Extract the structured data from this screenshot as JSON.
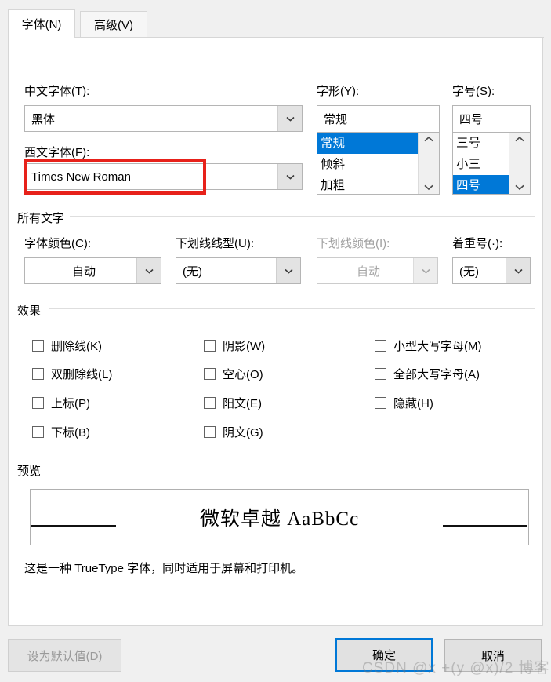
{
  "window": {
    "tabs": [
      {
        "id": "font",
        "label": "字体(N)"
      },
      {
        "id": "advanced",
        "label": "高级(V)"
      }
    ],
    "active_tab": "字体(N)"
  },
  "font_section": {
    "chinese_font": {
      "label": "中文字体(T):",
      "value": "黑体"
    },
    "western_font": {
      "label": "西文字体(F):",
      "value": "Times New Roman",
      "highlighted": true
    },
    "font_style": {
      "label": "字形(Y):",
      "value": "常规",
      "options": [
        "常规",
        "倾斜",
        "加粗"
      ],
      "selected": "常规"
    },
    "font_size": {
      "label": "字号(S):",
      "value": "四号",
      "options": [
        "三号",
        "小三",
        "四号"
      ],
      "selected": "四号"
    }
  },
  "all_text": {
    "group_title": "所有文字",
    "font_color": {
      "label": "字体颜色(C):",
      "value": "自动",
      "disabled": false
    },
    "underline_style": {
      "label": "下划线线型(U):",
      "value": "(无)",
      "disabled": false
    },
    "underline_color": {
      "label": "下划线颜色(I):",
      "value": "自动",
      "disabled": true
    },
    "emphasis_mark": {
      "label": "着重号(·):",
      "value": "(无)",
      "disabled": false
    }
  },
  "effects": {
    "group_title": "效果",
    "column1": [
      {
        "label": "删除线(K)",
        "checked": false
      },
      {
        "label": "双删除线(L)",
        "checked": false
      },
      {
        "label": "上标(P)",
        "checked": false
      },
      {
        "label": "下标(B)",
        "checked": false
      }
    ],
    "column2": [
      {
        "label": "阴影(W)",
        "checked": false
      },
      {
        "label": "空心(O)",
        "checked": false
      },
      {
        "label": "阳文(E)",
        "checked": false
      },
      {
        "label": "阴文(G)",
        "checked": false
      }
    ],
    "column3": [
      {
        "label": "小型大写字母(M)",
        "checked": false
      },
      {
        "label": "全部大写字母(A)",
        "checked": false
      },
      {
        "label": "隐藏(H)",
        "checked": false
      }
    ]
  },
  "preview": {
    "group_title": "预览",
    "sample_text": "微软卓越  AaBbCc",
    "note": "这是一种 TrueType 字体，同时适用于屏幕和打印机。"
  },
  "footer": {
    "set_default": "设为默认值(D)",
    "ok": "确定",
    "cancel": "取消"
  },
  "watermark": "CSDN @x +(y @x)/2 博客",
  "colors": {
    "accent": "#0078d7",
    "annotation": "#e7211a",
    "window_bg": "#f0f0f0",
    "panel_bg": "#ffffff"
  }
}
